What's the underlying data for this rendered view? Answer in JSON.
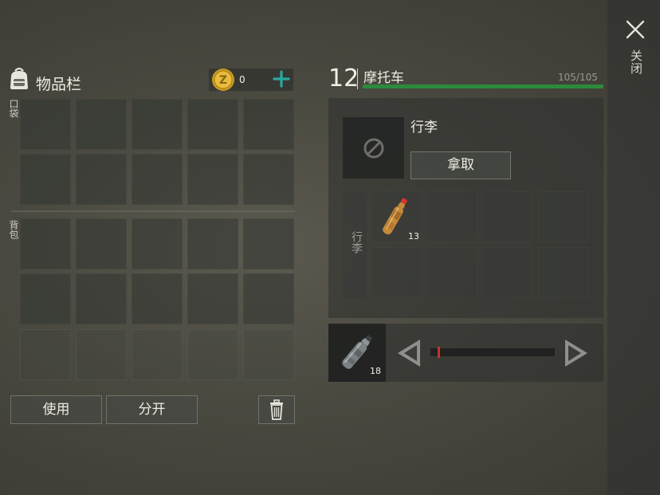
{
  "close": {
    "label": "关闭"
  },
  "inventory": {
    "title": "物品栏",
    "coins": "0",
    "pocket_label": "口袋",
    "backpack_label": "背包",
    "use_label": "使用",
    "split_label": "分开"
  },
  "vehicle": {
    "level": "12",
    "name": "摩托车",
    "durability": "105/105",
    "durability_fraction": 1.0,
    "luggage_title": "行李",
    "take_label": "拿取",
    "tab_label": "行李",
    "items": [
      {
        "icon": "red-cap-bottle-icon",
        "count": "13"
      }
    ]
  },
  "fuel": {
    "item": {
      "icon": "plastic-bottle-icon",
      "count": "18"
    },
    "slider_value": 0.06
  },
  "colors": {
    "durability_bar": "#2c8a3c",
    "accent_plus": "#29a9a0",
    "slider_marker": "#c5342c"
  }
}
